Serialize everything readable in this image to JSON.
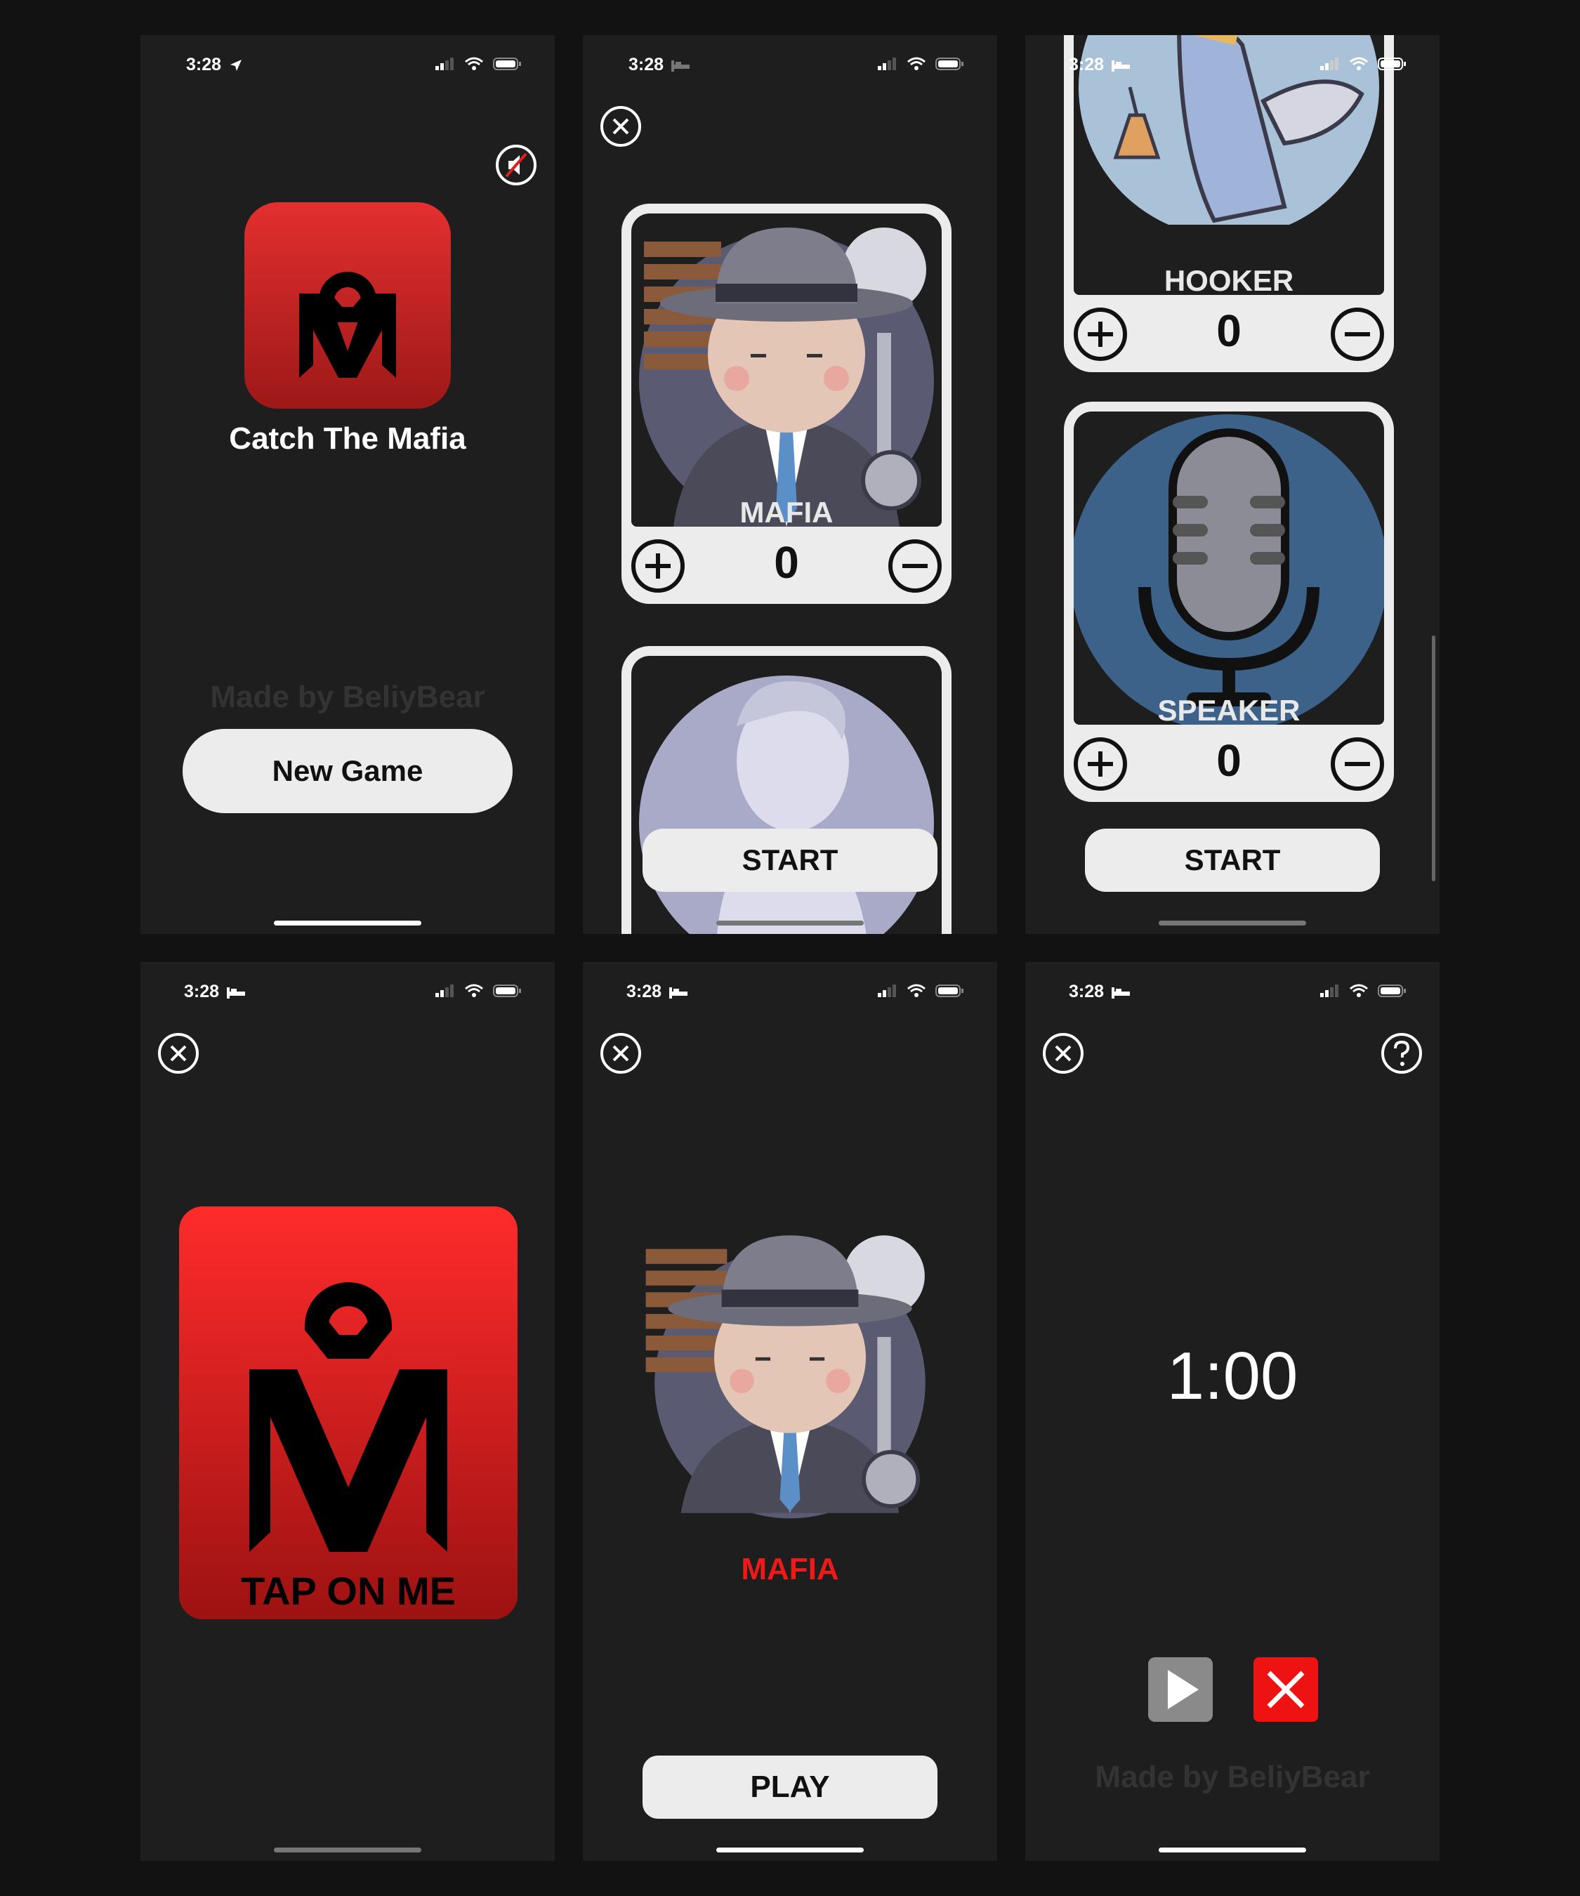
{
  "status": {
    "time": "3:28"
  },
  "home": {
    "title": "Catch The Mafia",
    "made_by": "Made by BeliyBear",
    "new_game": "New Game"
  },
  "roles": [
    {
      "label": "MAFIA",
      "count": "0"
    },
    {
      "label": "HOOKER",
      "count": "0"
    },
    {
      "label": "SPEAKER",
      "count": "0"
    }
  ],
  "setup": {
    "start": "START"
  },
  "reveal": {
    "tap_label": "TAP ON ME"
  },
  "role_card": {
    "role": "MAFIA",
    "play": "PLAY"
  },
  "timer": {
    "time": "1:00",
    "made_by": "Made by BeliyBear"
  },
  "colors": {
    "accent_red": "#ee1a1a",
    "background": "#1e1e1e",
    "button_bg": "#ececec"
  },
  "icons": [
    "location-arrow-icon",
    "bed-icon",
    "signal-icon",
    "wifi-icon",
    "battery-icon",
    "mute-icon",
    "close-icon",
    "help-icon",
    "plus-icon",
    "minus-icon",
    "play-icon",
    "stop-icon"
  ]
}
